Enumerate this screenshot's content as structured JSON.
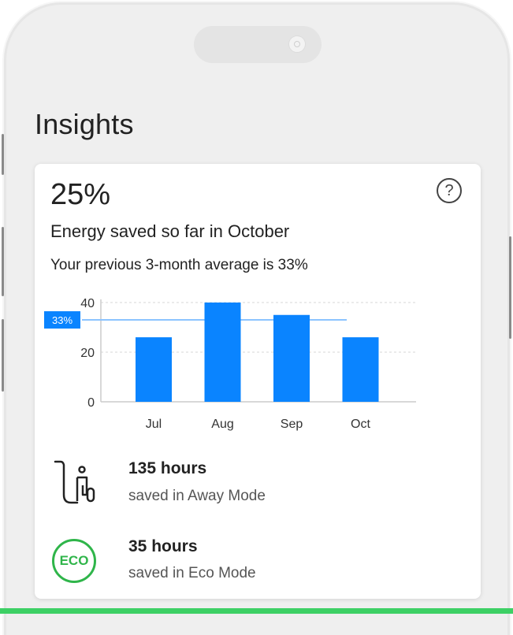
{
  "screen": {
    "title": "Insights"
  },
  "card": {
    "savings_percent": "25%",
    "subtitle": "Energy saved so far in October",
    "average_text": "Your previous 3-month average is 33%",
    "help_symbol": "?"
  },
  "chart_data": {
    "type": "bar",
    "categories": [
      "Jul",
      "Aug",
      "Sep",
      "Oct"
    ],
    "values": [
      26,
      40,
      35,
      26
    ],
    "ylim": [
      0,
      40
    ],
    "yticks": [
      "0",
      "20",
      "40"
    ],
    "reference_line": {
      "value": 33,
      "label": "33%"
    },
    "grid": true,
    "bar_color": "#0a84ff",
    "reference_color": "#8cc4ff"
  },
  "stats": [
    {
      "icon": "away-mode-icon",
      "title": "135 hours",
      "subtitle": "saved in Away Mode"
    },
    {
      "icon": "eco-icon",
      "icon_text": "ECO",
      "title": "35 hours",
      "subtitle": "saved in Eco Mode"
    }
  ],
  "colors": {
    "eco_green": "#2fb54a",
    "accent_green": "#3dd065",
    "text": "#222222"
  }
}
